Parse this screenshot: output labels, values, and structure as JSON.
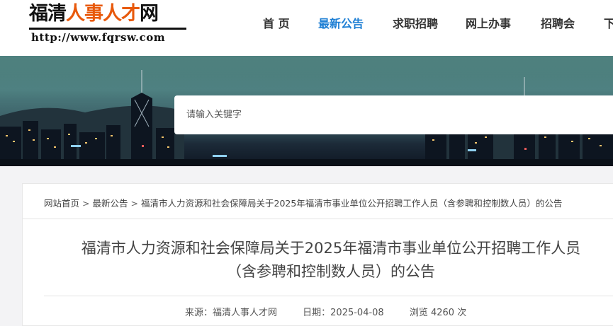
{
  "logo": {
    "title_part1": "福清",
    "title_part2": "人事人才",
    "title_part3": "网",
    "url": "http://www.fqrsw.com"
  },
  "nav": {
    "items": [
      {
        "label": "首 页"
      },
      {
        "label": "最新公告"
      },
      {
        "label": "求职招聘"
      },
      {
        "label": "网上办事"
      },
      {
        "label": "招聘会"
      },
      {
        "label": "下"
      }
    ],
    "active_index": 1,
    "active_color": "#1e7fd4"
  },
  "search": {
    "placeholder": "请输入关键字",
    "value": ""
  },
  "breadcrumb": {
    "items": [
      {
        "label": "网站首页"
      },
      {
        "label": "最新公告"
      },
      {
        "label": "福清市人力资源和社会保障局关于2025年福清市事业单位公开招聘工作人员（含参聘和控制数人员）的公告"
      }
    ],
    "separator": ">"
  },
  "article": {
    "title_line1": "福清市人力资源和社会保障局关于2025年福清市事业单位公开招聘工作人员",
    "title_line2": "（含参聘和控制数人员）的公告",
    "source": "来源：福清人事人才网",
    "date": "日期：2025-04-08",
    "views": "浏览 4260 次"
  }
}
